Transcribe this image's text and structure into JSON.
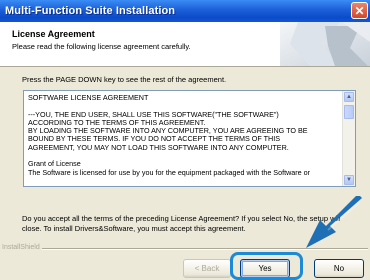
{
  "window": {
    "title": "Multi-Function Suite Installation",
    "close_symbol": "✕"
  },
  "header": {
    "title": "License Agreement",
    "subtitle": "Please read the following license agreement carefully."
  },
  "instruction": "Press the PAGE DOWN key to see the rest of the agreement.",
  "license_text": "SOFTWARE LICENSE AGREEMENT\n\n---YOU, THE END USER, SHALL USE THIS SOFTWARE(\"THE SOFTWARE\")\nACCORDING TO THE TERMS OF THIS AGREEMENT.\nBY LOADING THE SOFTWARE INTO ANY COMPUTER, YOU ARE AGREEING TO BE\nBOUND BY THESE TERMS. IF YOU DO NOT ACCEPT THE TERMS OF THIS\nAGREEMENT, YOU MAY NOT LOAD THIS SOFTWARE INTO ANY COMPUTER.\n\nGrant of License\nThe Software is licensed for use by you for the equipment packaged with the Software or",
  "question": "Do you accept all the terms of the preceding License Agreement? If you select No, the setup will close. To install Drivers&Software, you must accept this agreement.",
  "footer_brand": "InstallShield",
  "buttons": {
    "back": "< Back",
    "yes": "Yes",
    "no": "No"
  },
  "colors": {
    "titlebar": "#0b4bc9",
    "highlight": "#1d8ad6",
    "arrow": "#1f6fb5"
  }
}
